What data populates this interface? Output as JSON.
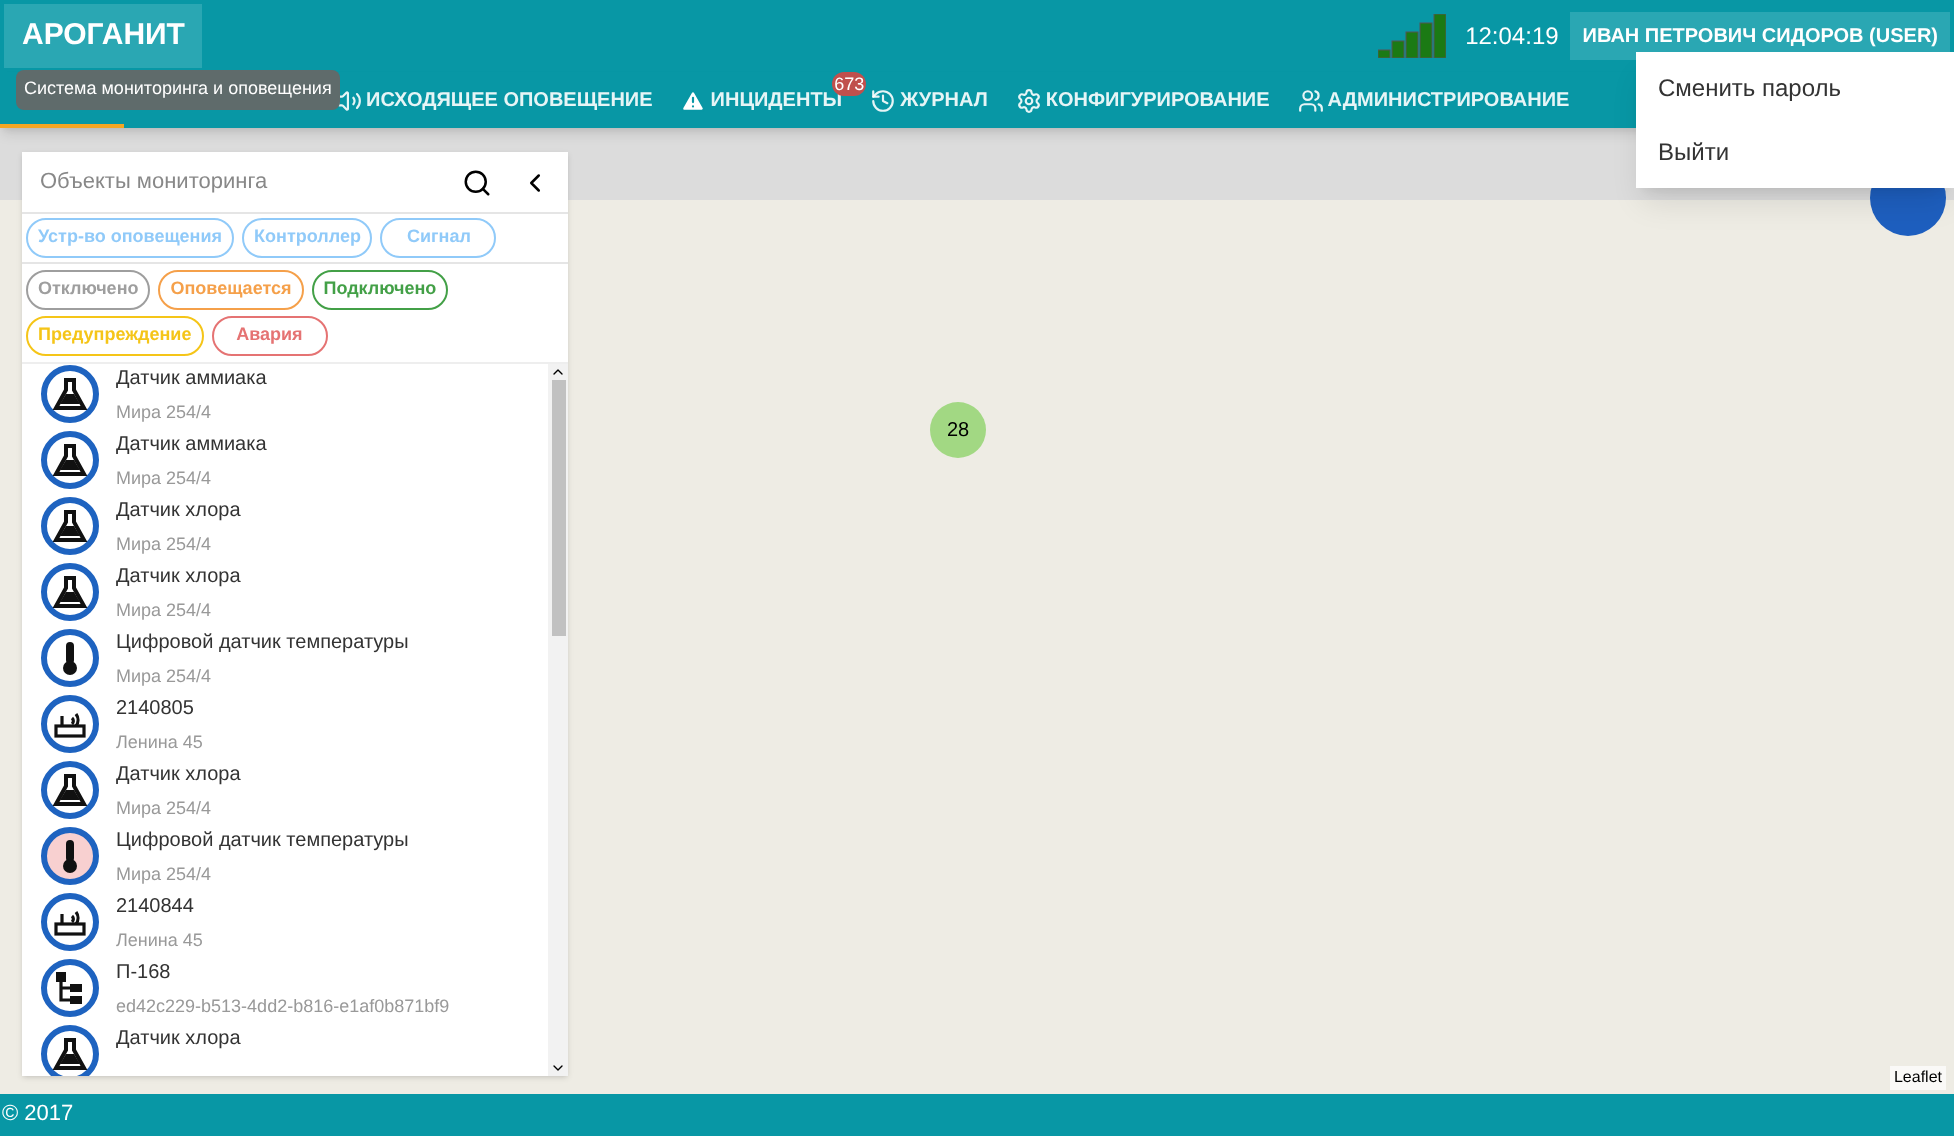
{
  "header": {
    "logo": "АРОГАНИТ",
    "time": "12:04:19",
    "user": "ИВАН ПЕТРОВИЧ СИДОРОВ (USER)"
  },
  "tooltip": "Система мониторинга и оповещения",
  "nav": [
    {
      "kind": "hidden",
      "selected": true
    },
    {
      "kind": "speaker",
      "label": "ИСХОДЯЩЕЕ ОПОВЕЩЕНИЕ",
      "selected": false
    },
    {
      "kind": "warning",
      "label": "ИНЦИДЕНТЫ",
      "badge": "673",
      "selected": false
    },
    {
      "kind": "history",
      "label": "ЖУРНАЛ",
      "selected": false
    },
    {
      "kind": "gear",
      "label": "КОНФИГУРИРОВАНИЕ",
      "selected": false
    },
    {
      "kind": "people",
      "label": "АДМИНИСТРИРОВАНИЕ",
      "selected": false
    }
  ],
  "user_menu": [
    "Сменить пароль",
    "Выйти"
  ],
  "panel": {
    "placeholder": "Объекты мониторинга",
    "type_filters": [
      {
        "label": "Устр-во оповещения",
        "color": "#90caf9"
      },
      {
        "label": "Контроллер",
        "color": "#90caf9"
      },
      {
        "label": "Сигнал",
        "color": "#90caf9"
      }
    ],
    "status_filters": [
      {
        "label": "Отключено",
        "color": "#9e9e9e"
      },
      {
        "label": "Оповещается",
        "color": "#f5a04a"
      },
      {
        "label": "Подключено",
        "color": "#43a047"
      },
      {
        "label": "Предупреждение",
        "color": "#f5c518"
      },
      {
        "label": "Авария",
        "color": "#e57373"
      }
    ],
    "items": [
      {
        "kind": "flask",
        "name": "Датчик аммиака",
        "address": "Мира 254/4",
        "alarm": false
      },
      {
        "kind": "flask",
        "name": "Датчик аммиака",
        "address": "Мира 254/4",
        "alarm": false
      },
      {
        "kind": "flask",
        "name": "Датчик хлора",
        "address": "Мира 254/4",
        "alarm": false
      },
      {
        "kind": "flask",
        "name": "Датчик хлора",
        "address": "Мира 254/4",
        "alarm": false
      },
      {
        "kind": "thermometer",
        "name": "Цифровой датчик температуры",
        "address": "Мира 254/4",
        "alarm": false
      },
      {
        "kind": "router",
        "name": "2140805",
        "address": "Ленина 45",
        "alarm": false
      },
      {
        "kind": "flask",
        "name": "Датчик хлора",
        "address": "Мира 254/4",
        "alarm": false
      },
      {
        "kind": "thermometer",
        "name": "Цифровой датчик температуры",
        "address": "Мира 254/4",
        "alarm": true
      },
      {
        "kind": "router",
        "name": "2140844",
        "address": "Ленина 45",
        "alarm": false
      },
      {
        "kind": "network",
        "name": "П-168",
        "address": "ed42c229-b513-4dd2-b816-e1af0b871bf9",
        "alarm": false
      },
      {
        "kind": "flask",
        "name": "Датчик хлора",
        "alarm": false
      }
    ]
  },
  "map": {
    "cluster": "28",
    "attribution": "Leaflet"
  },
  "footer": "© 2017"
}
